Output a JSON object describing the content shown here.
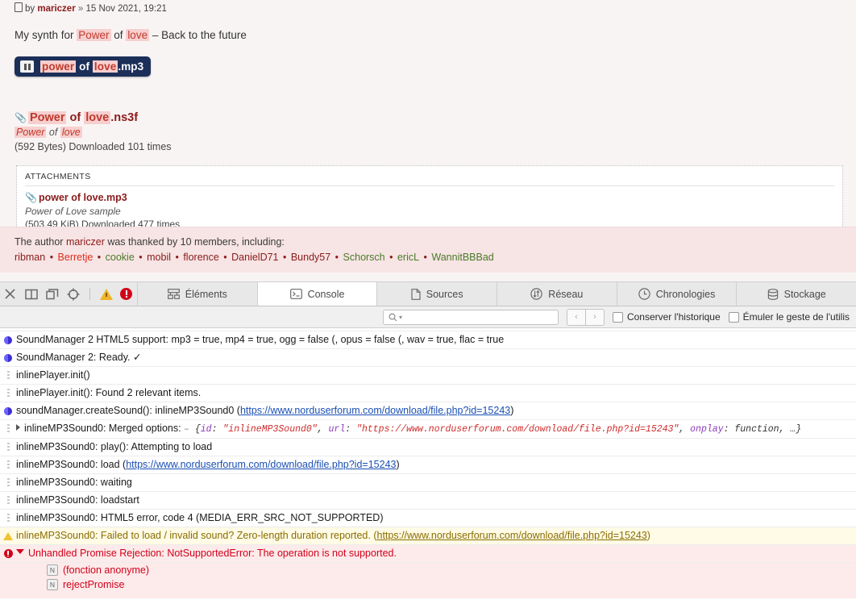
{
  "post": {
    "head": {
      "by_label": "by",
      "author": "mariczer",
      "separator": "»",
      "date": "15 Nov 2021, 19:21"
    },
    "body": {
      "pre": "My synth for ",
      "hl1": "Power",
      "mid": " of ",
      "hl2": "love",
      "post": " – Back to the future"
    },
    "player": {
      "pre": "",
      "hl1": "power",
      "mid": " of ",
      "hl2": "love",
      "post": ".mp3",
      "state": "playing"
    },
    "inline_attachment": {
      "name_hl1": "Power",
      "name_mid": " of ",
      "name_hl2": "love",
      "name_ext": ".ns3f",
      "comment_hl1": "Power",
      "comment_mid": " of ",
      "comment_hl2": "love",
      "meta": "(592 Bytes) Downloaded 101 times"
    },
    "attachments_panel": {
      "title": "ATTACHMENTS",
      "items": [
        {
          "filename": "power of love.mp3",
          "comment": "Power of Love sample",
          "meta": "(503.49 KiB) Downloaded 477 times"
        }
      ]
    },
    "thanks": {
      "prefix": "The author ",
      "author": "mariczer",
      "suffix": " was thanked by 10 members, including:",
      "members": [
        {
          "name": "ribman",
          "color_class": "uname-dark"
        },
        {
          "name": "Berretje",
          "color_class": "uname-red"
        },
        {
          "name": "cookie",
          "color_class": "uname-green"
        },
        {
          "name": "mobil",
          "color_class": "uname-dark"
        },
        {
          "name": "florence",
          "color_class": "uname-dark"
        },
        {
          "name": "DanielD71",
          "color_class": "uname-dark"
        },
        {
          "name": "Bundy57",
          "color_class": "uname-dark"
        },
        {
          "name": "Schorsch",
          "color_class": "uname-green"
        },
        {
          "name": "ericL",
          "color_class": "uname-green"
        },
        {
          "name": "WannitBBBad",
          "color_class": "uname-green"
        }
      ],
      "bullet": "•"
    }
  },
  "inspector": {
    "toolbar_icons": [
      {
        "name": "close-icon",
        "glyph": "✕"
      },
      {
        "name": "dock-right-icon",
        "glyph": "▥"
      },
      {
        "name": "dock-bottom-icon",
        "glyph": "❐"
      },
      {
        "name": "inspect-element-icon",
        "glyph": "⊕"
      }
    ],
    "tabs": [
      {
        "label": "Éléments",
        "icon": "elements-icon",
        "active": false
      },
      {
        "label": "Console",
        "icon": "console-icon",
        "active": true
      },
      {
        "label": "Sources",
        "icon": "sources-icon",
        "active": false
      },
      {
        "label": "Réseau",
        "icon": "network-icon",
        "active": false
      },
      {
        "label": "Chronologies",
        "icon": "timelines-icon",
        "active": false
      },
      {
        "label": "Stockage",
        "icon": "storage-icon",
        "active": false
      }
    ],
    "filterbar": {
      "search_placeholder": "",
      "search_value": "",
      "prev_label": "‹",
      "next_label": "›",
      "checkbox_preserve_log": "Conserver l'historique",
      "checkbox_emulate_gesture": "Émuler le geste de l'utilis"
    },
    "console_rows": [
      {
        "icon": "log-icon",
        "type": "clipped",
        "text": ""
      },
      {
        "icon": "info-icon",
        "type": "info",
        "text": "SoundManager 2 HTML5 support: mp3 = true, mp4 = true, ogg = false (, opus = false (, wav = true, flac = true"
      },
      {
        "icon": "info-icon",
        "type": "info",
        "text": "SoundManager 2: Ready. ✓"
      },
      {
        "icon": "log-icon",
        "type": "log",
        "text": "inlinePlayer.init()"
      },
      {
        "icon": "log-icon",
        "type": "log",
        "text": "inlinePlayer.init(): Found 2 relevant items."
      },
      {
        "icon": "info-icon",
        "type": "info-link",
        "text_before": "soundManager.createSound(): inlineMP3Sound0 (",
        "link": "https://www.norduserforum.com/download/file.php?id=15243",
        "text_after": ")"
      },
      {
        "icon": "log-icon",
        "type": "object",
        "text_before": "inlineMP3Sound0: Merged options: ",
        "dash": "–",
        "obj_open": "{",
        "obj_key1": "id",
        "obj_val1": "\"inlineMP3Sound0\"",
        "obj_key2": "url",
        "obj_val2": "\"https://www.norduserforum.com/download/file.php?id=15243\"",
        "obj_key3": "onplay",
        "obj_val3": "function",
        "obj_tail": ", …}"
      },
      {
        "icon": "log-icon",
        "type": "log",
        "text": "inlineMP3Sound0: play(): Attempting to load"
      },
      {
        "icon": "log-icon",
        "type": "log-link",
        "text_before": "inlineMP3Sound0: load (",
        "link": "https://www.norduserforum.com/download/file.php?id=15243",
        "text_after": ")"
      },
      {
        "icon": "log-icon",
        "type": "log",
        "text": "inlineMP3Sound0: waiting"
      },
      {
        "icon": "log-icon",
        "type": "log",
        "text": "inlineMP3Sound0: loadstart"
      },
      {
        "icon": "log-icon",
        "type": "log",
        "text": "inlineMP3Sound0: HTML5 error, code 4 (MEDIA_ERR_SRC_NOT_SUPPORTED)"
      },
      {
        "icon": "warning-icon",
        "type": "warning",
        "text_before": "inlineMP3Sound0: Failed to load / invalid sound? Zero-length duration reported. (",
        "link": "https://www.norduserforum.com/download/file.php?id=15243",
        "text_after": ")"
      },
      {
        "icon": "error-icon",
        "type": "error",
        "text": "Unhandled Promise Rejection: NotSupportedError: The operation is not supported.",
        "stack": [
          {
            "badge": "N",
            "label": "(fonction anonyme)"
          },
          {
            "badge": "N",
            "label": "rejectPromise"
          }
        ]
      }
    ]
  }
}
